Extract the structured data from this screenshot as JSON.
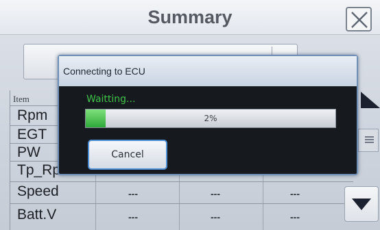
{
  "window": {
    "title": "Summary"
  },
  "table": {
    "header": "Item",
    "rows": [
      {
        "label": "Rpm",
        "values": [
          "",
          "",
          ""
        ]
      },
      {
        "label": "EGT",
        "values": [
          "",
          "",
          ""
        ]
      },
      {
        "label": "PW",
        "values": [
          "",
          "",
          ""
        ]
      },
      {
        "label": "Tp_Rpm",
        "values": [
          "---",
          "---",
          "---"
        ]
      },
      {
        "label": "Speed",
        "values": [
          "---",
          "---",
          "---"
        ]
      },
      {
        "label": "Batt.V",
        "values": [
          "---",
          "---",
          "---"
        ]
      }
    ]
  },
  "dialog": {
    "title": "Connecting to ECU",
    "status": "Waitting...",
    "progress_text": "2%",
    "progress_fraction": 0.02,
    "cancel_label": "Cancel"
  },
  "colors": {
    "dialog_border": "#6d8fb8",
    "status_text": "#3fc44a",
    "cancel_border": "#4d8fd6"
  },
  "icons": {
    "close": "close-icon",
    "scroll_up": "triangle-up-icon",
    "scroll_down": "triangle-down-icon",
    "scroll_mid": "menu-lines-icon"
  }
}
